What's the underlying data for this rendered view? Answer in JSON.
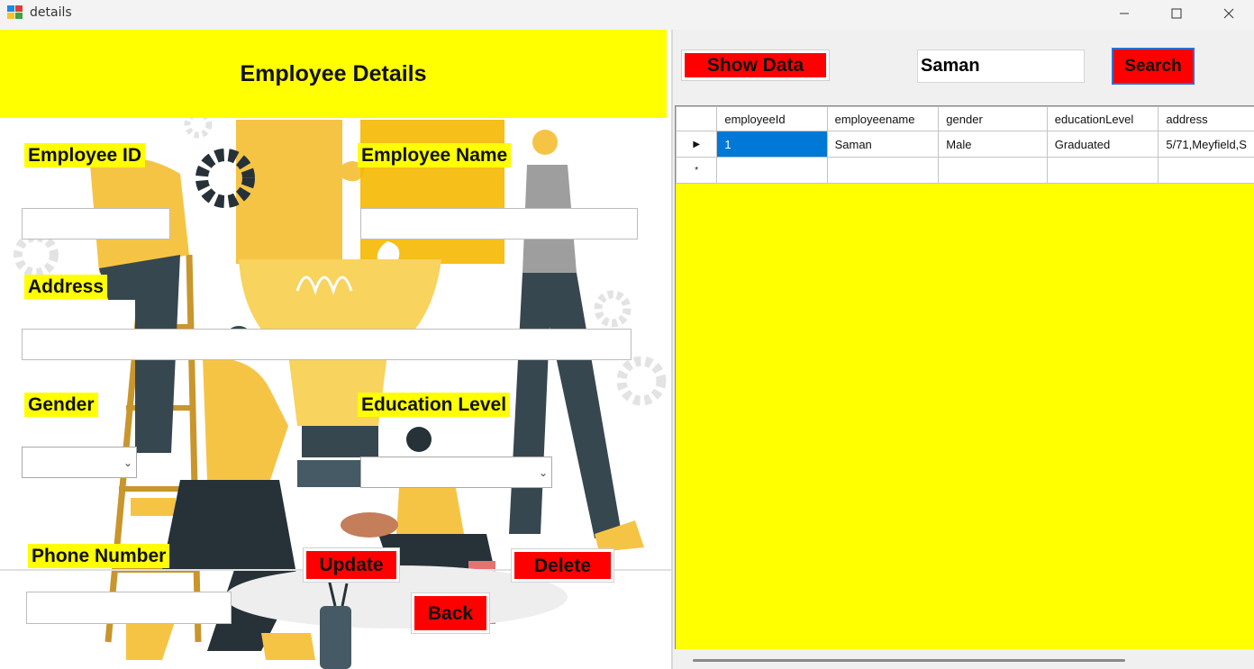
{
  "window": {
    "title": "details"
  },
  "form": {
    "heading": "Employee Details",
    "employee_id": {
      "label": "Employee ID",
      "value": ""
    },
    "employee_name": {
      "label": "Employee Name",
      "value": ""
    },
    "address": {
      "label": "Address",
      "value": ""
    },
    "gender": {
      "label": "Gender",
      "value": ""
    },
    "education_level": {
      "label": "Education Level",
      "value": ""
    },
    "phone_number": {
      "label": "Phone Number",
      "value": ""
    },
    "buttons": {
      "update": "Update",
      "delete": "Delete",
      "back": "Back"
    }
  },
  "toolbar": {
    "show_data": "Show Data",
    "search_value": "Saman",
    "search": "Search"
  },
  "grid": {
    "columns": [
      "employeeId",
      "employeename",
      "gender",
      "educationLevel",
      "address"
    ],
    "rows": [
      {
        "indicator": "▶",
        "cells": [
          "1",
          "Saman",
          "Male",
          "Graduated",
          "5/71,Meyfield,S"
        ]
      },
      {
        "indicator": "*",
        "cells": [
          "",
          "",
          "",
          "",
          ""
        ]
      }
    ]
  },
  "colors": {
    "accent_yellow": "#ffff00",
    "button_red": "#ff0000",
    "selection_blue": "#0078d7"
  }
}
